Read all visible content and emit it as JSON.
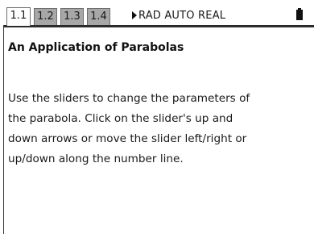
{
  "tabs": [
    {
      "label": "1.1",
      "active": true
    },
    {
      "label": "1.2",
      "active": false
    },
    {
      "label": "1.3",
      "active": false
    },
    {
      "label": "1.4",
      "active": false
    }
  ],
  "status": {
    "text": "RAD AUTO REAL",
    "arrow_icon": "right-triangle-icon",
    "battery_icon": "battery-icon"
  },
  "document": {
    "title": "An Application of Parabolas",
    "body_lines": [
      "Use the sliders to change the parameters of",
      "the parabola. Click on the slider's up and",
      "down arrows or move the slider left/right or",
      "up/down along the number line."
    ]
  },
  "colors": {
    "inactive_tab": "#a7a7a7",
    "active_tab": "#ffffff",
    "text": "#1a1a1a"
  }
}
